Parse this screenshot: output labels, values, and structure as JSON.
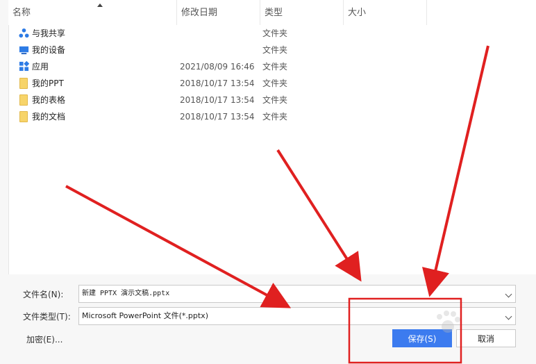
{
  "header": {
    "col_name": "名称",
    "col_date": "修改日期",
    "col_type": "类型",
    "col_size": "大小"
  },
  "rows": [
    {
      "name": "与我共享",
      "date": "",
      "type": "文件夹",
      "icon": "share-icon"
    },
    {
      "name": "我的设备",
      "date": "",
      "type": "文件夹",
      "icon": "device-icon"
    },
    {
      "name": "应用",
      "date": "2021/08/09 16:46",
      "type": "文件夹",
      "icon": "apps-icon"
    },
    {
      "name": "我的PPT",
      "date": "2018/10/17 13:54",
      "type": "文件夹",
      "icon": "folder-icon"
    },
    {
      "name": "我的表格",
      "date": "2018/10/17 13:54",
      "type": "文件夹",
      "icon": "folder-icon"
    },
    {
      "name": "我的文档",
      "date": "2018/10/17 13:54",
      "type": "文件夹",
      "icon": "folder-icon"
    }
  ],
  "footer": {
    "filename_label": "文件名(N):",
    "filename_value": "新建 PPTX 演示文稿.pptx",
    "filetype_label": "文件类型(T):",
    "filetype_value": "Microsoft PowerPoint 文件(*.pptx)",
    "encrypt_label": "加密(E)...",
    "save_label": "保存(S)",
    "cancel_label": "取消"
  },
  "colors": {
    "accent": "#3c7bef",
    "annotation": "#e02020"
  }
}
